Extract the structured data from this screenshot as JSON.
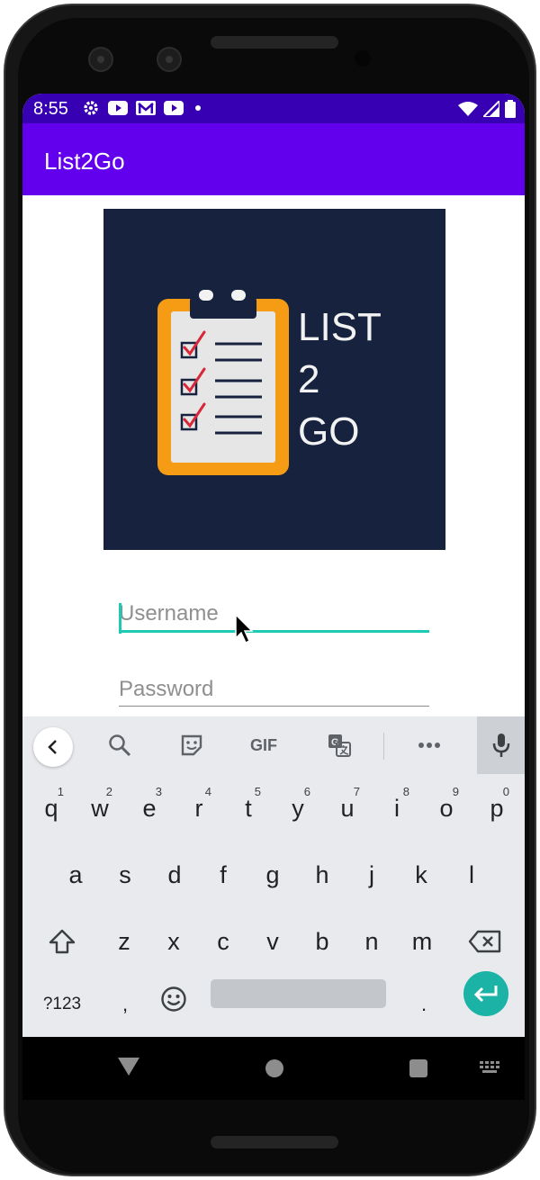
{
  "status_bar": {
    "time": "8:55",
    "icons_left": [
      "gear-icon",
      "youtube-icon",
      "gmail-icon",
      "youtube-icon",
      "dot-icon"
    ],
    "icons_right": [
      "wifi-icon",
      "signal-icon",
      "battery-icon"
    ],
    "color": "#3700b3"
  },
  "app_bar": {
    "title": "List2Go",
    "color": "#6200ee"
  },
  "logo": {
    "line1": "LIST",
    "line2": "2",
    "line3": "GO",
    "background": "#17223f"
  },
  "form": {
    "username_placeholder": "Username",
    "password_placeholder": "Password",
    "accent": "#1ccab5"
  },
  "keyboard": {
    "toolbar": [
      "back-icon",
      "search-icon",
      "sticker-icon",
      "GIF",
      "translate-icon",
      "more-icon",
      "mic-icon"
    ],
    "gif_label": "GIF",
    "row1": [
      {
        "key": "q",
        "hint": "1"
      },
      {
        "key": "w",
        "hint": "2"
      },
      {
        "key": "e",
        "hint": "3"
      },
      {
        "key": "r",
        "hint": "4"
      },
      {
        "key": "t",
        "hint": "5"
      },
      {
        "key": "y",
        "hint": "6"
      },
      {
        "key": "u",
        "hint": "7"
      },
      {
        "key": "i",
        "hint": "8"
      },
      {
        "key": "o",
        "hint": "9"
      },
      {
        "key": "p",
        "hint": "0"
      }
    ],
    "row2": [
      "a",
      "s",
      "d",
      "f",
      "g",
      "h",
      "j",
      "k",
      "l"
    ],
    "row3": [
      "z",
      "x",
      "c",
      "v",
      "b",
      "n",
      "m"
    ],
    "symbols_label": "?123",
    "comma": ",",
    "period": ".",
    "enter_color": "#1ab3a5"
  },
  "nav_bar": {
    "icons": [
      "back-triangle-icon",
      "home-circle-icon",
      "recents-square-icon",
      "keyboard-switch-icon"
    ]
  }
}
